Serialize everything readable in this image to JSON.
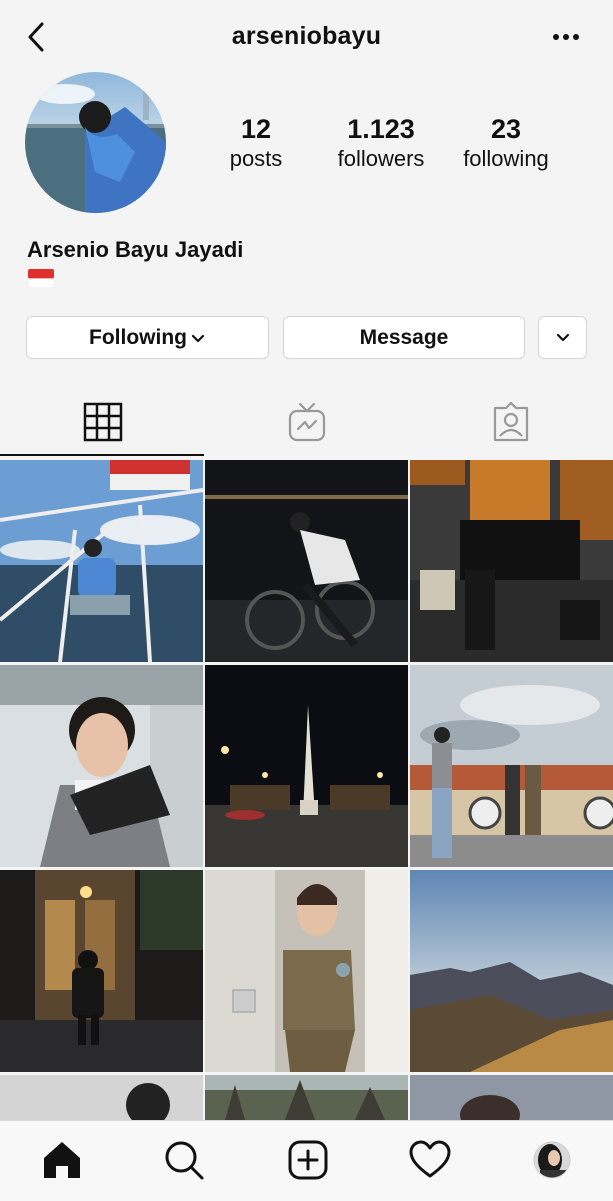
{
  "header": {
    "username": "arseniobayu",
    "back_icon": "chevron-left-icon",
    "more_icon": "more-horizontal-icon"
  },
  "profile": {
    "full_name": "Arsenio Bayu Jayadi",
    "bio_emoji": "indonesia-flag",
    "stats": {
      "posts": {
        "value": "12",
        "label": "posts"
      },
      "followers": {
        "value": "1.123",
        "label": "followers"
      },
      "following": {
        "value": "23",
        "label": "following"
      }
    }
  },
  "actions": {
    "following_label": "Following",
    "message_label": "Message"
  },
  "tabs": [
    {
      "name": "grid",
      "icon": "grid-icon",
      "active": true
    },
    {
      "name": "igtv",
      "icon": "igtv-icon",
      "active": false
    },
    {
      "name": "tagged",
      "icon": "tagged-user-icon",
      "active": false
    }
  ],
  "posts": [
    {
      "name": "post-boat-deck"
    },
    {
      "name": "post-night-bicycle"
    },
    {
      "name": "post-batik-group"
    },
    {
      "name": "post-child-portrait"
    },
    {
      "name": "post-night-monument"
    },
    {
      "name": "post-bridge-friends"
    },
    {
      "name": "post-night-alley"
    },
    {
      "name": "post-brown-uniform"
    },
    {
      "name": "post-mountain-sunrise"
    },
    {
      "name": "post-partial-1"
    },
    {
      "name": "post-partial-temple"
    },
    {
      "name": "post-partial-3"
    }
  ],
  "bottom_nav": [
    {
      "name": "home",
      "icon": "home-icon"
    },
    {
      "name": "search",
      "icon": "search-icon"
    },
    {
      "name": "new-post",
      "icon": "add-post-icon"
    },
    {
      "name": "activity",
      "icon": "heart-icon"
    },
    {
      "name": "profile",
      "icon": "profile-avatar-icon"
    }
  ],
  "colors": {
    "background": "#f4f4f4",
    "text": "#111111",
    "border": "#d4d4d4"
  }
}
